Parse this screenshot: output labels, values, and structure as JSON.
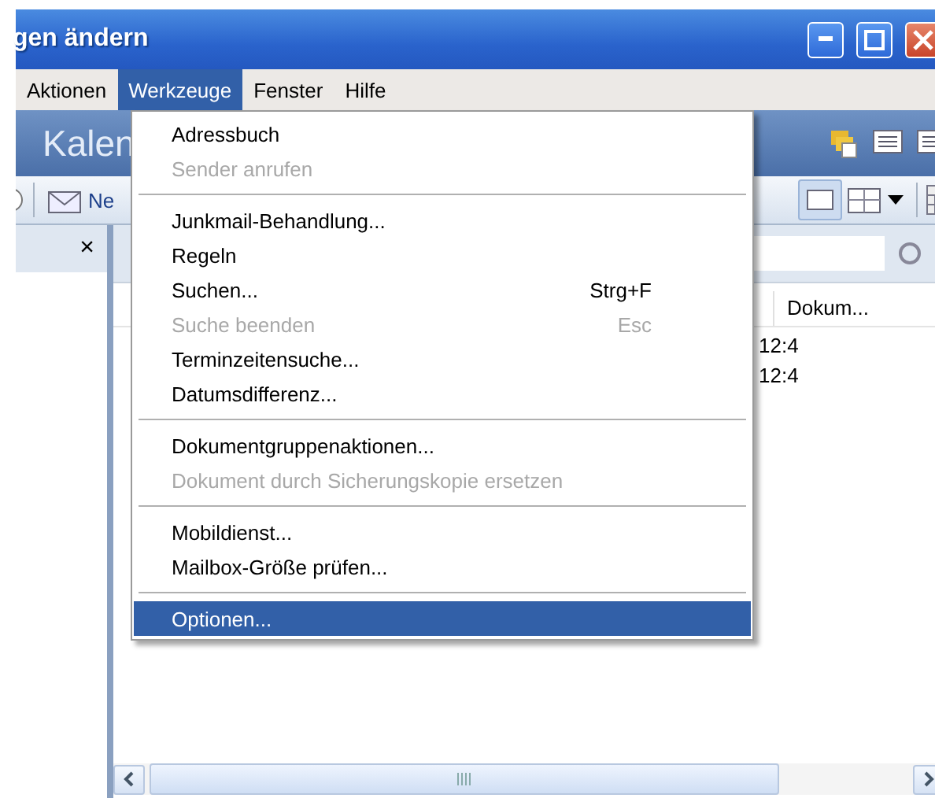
{
  "window": {
    "title": "gen ändern"
  },
  "menu_bar": [
    {
      "label": "Aktionen",
      "selected": false
    },
    {
      "label": "Werkzeuge",
      "selected": true
    },
    {
      "label": "Fenster",
      "selected": false
    },
    {
      "label": "Hilfe",
      "selected": false
    }
  ],
  "header": {
    "title": "Kalen"
  },
  "toolbar": {
    "new_button": "Ne"
  },
  "left_pane": {
    "close": "×"
  },
  "list": {
    "columns": [
      "Dokum..."
    ],
    "rows": [
      {
        "time": "12:4"
      },
      {
        "time": "12:4"
      }
    ]
  },
  "dropdown_menu": {
    "items": [
      {
        "kind": "item",
        "label": "Adressbuch",
        "disabled": false,
        "selected": false
      },
      {
        "kind": "item",
        "label": "Sender anrufen",
        "disabled": true,
        "selected": false
      },
      {
        "kind": "separator"
      },
      {
        "kind": "item",
        "label": "Junkmail-Behandlung...",
        "disabled": false,
        "selected": false
      },
      {
        "kind": "item",
        "label": "Regeln",
        "disabled": false,
        "selected": false
      },
      {
        "kind": "item",
        "label": "Suchen...",
        "shortcut": "Strg+F",
        "disabled": false,
        "selected": false
      },
      {
        "kind": "item",
        "label": "Suche beenden",
        "shortcut": "Esc",
        "disabled": true,
        "selected": false
      },
      {
        "kind": "item",
        "label": "Terminzeitensuche...",
        "disabled": false,
        "selected": false
      },
      {
        "kind": "item",
        "label": "Datumsdifferenz...",
        "disabled": false,
        "selected": false
      },
      {
        "kind": "separator"
      },
      {
        "kind": "item",
        "label": "Dokumentgruppenaktionen...",
        "disabled": false,
        "selected": false
      },
      {
        "kind": "item",
        "label": "Dokument durch Sicherungskopie ersetzen",
        "disabled": true,
        "selected": false
      },
      {
        "kind": "separator"
      },
      {
        "kind": "item",
        "label": "Mobildienst...",
        "disabled": false,
        "selected": false
      },
      {
        "kind": "item",
        "label": "Mailbox-Größe prüfen...",
        "disabled": false,
        "selected": false
      },
      {
        "kind": "separator"
      },
      {
        "kind": "item",
        "label": "Optionen...",
        "disabled": false,
        "selected": true
      }
    ]
  }
}
